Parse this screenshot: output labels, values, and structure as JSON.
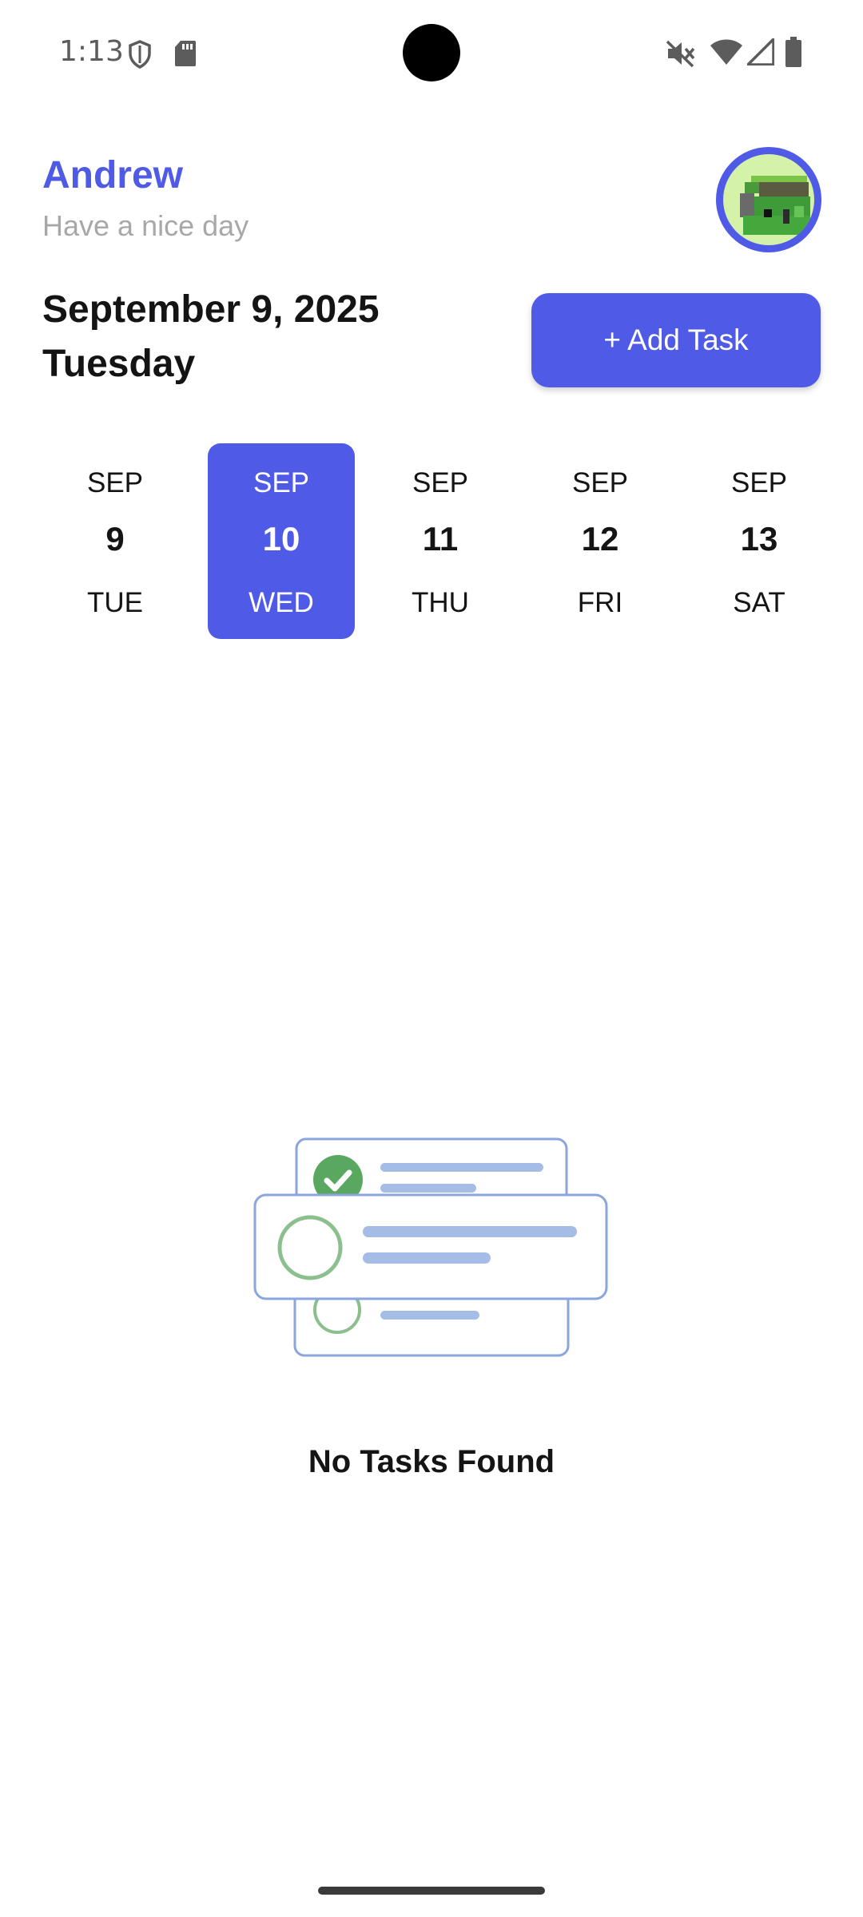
{
  "status_bar": {
    "time": "1:13",
    "icons": [
      "shield-icon",
      "sd-card-icon",
      "mute-icon",
      "wifi-icon",
      "signal-icon",
      "battery-icon"
    ]
  },
  "header": {
    "user_name": "Andrew",
    "greeting": "Have a nice day",
    "avatar_icon": "pixel-avatar-icon"
  },
  "date": {
    "full": "September 9, 2025",
    "weekday": "Tuesday"
  },
  "actions": {
    "add_task_label": "+ Add Task"
  },
  "day_picker": {
    "days": [
      {
        "month": "SEP",
        "day": "9",
        "weekday": "TUE",
        "selected": false
      },
      {
        "month": "SEP",
        "day": "10",
        "weekday": "WED",
        "selected": true
      },
      {
        "month": "SEP",
        "day": "11",
        "weekday": "THU",
        "selected": false
      },
      {
        "month": "SEP",
        "day": "12",
        "weekday": "FRI",
        "selected": false
      },
      {
        "month": "SEP",
        "day": "13",
        "weekday": "SAT",
        "selected": false
      }
    ]
  },
  "empty_state": {
    "message": "No Tasks Found",
    "illustration_icon": "task-list-illustration-icon"
  },
  "colors": {
    "accent": "#4f5ae6",
    "muted_text": "#a8a8a8",
    "illustration_blue": "#7f9fd8",
    "illustration_green": "#5aa85f"
  }
}
